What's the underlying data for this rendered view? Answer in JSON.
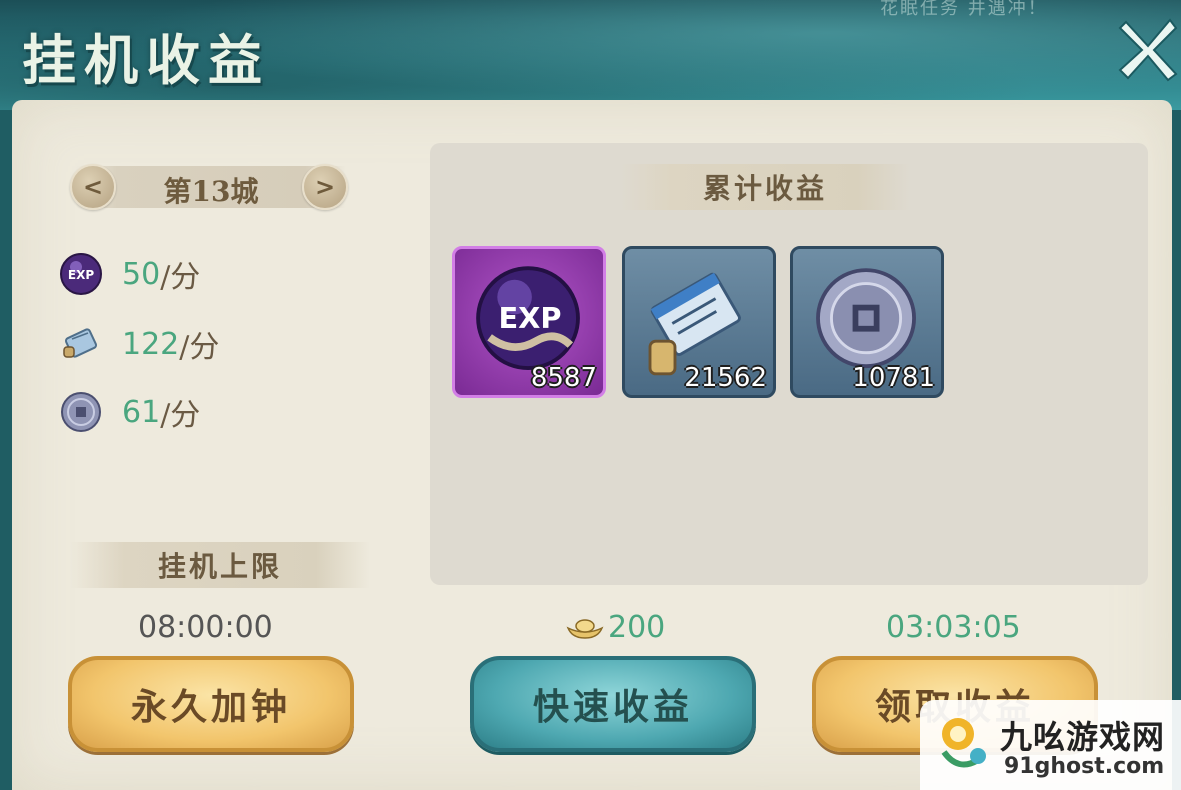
{
  "header": {
    "title": "挂机收益",
    "top_hint": "花眠任务  井遇冲！"
  },
  "city_selector": {
    "label": "第13城",
    "prev_symbol": "<",
    "next_symbol": ">"
  },
  "rates": [
    {
      "icon": "exp-orb-icon",
      "value": "50",
      "unit": "/分"
    },
    {
      "icon": "scroll-icon",
      "value": "122",
      "unit": "/分"
    },
    {
      "icon": "coin-icon",
      "value": "61",
      "unit": "/分"
    }
  ],
  "rewards": {
    "header": "累计收益",
    "items": [
      {
        "icon": "exp-orb-icon",
        "count": "8587",
        "frame": "purple"
      },
      {
        "icon": "scroll-icon",
        "count": "21562",
        "frame": "blue"
      },
      {
        "icon": "coin-icon",
        "count": "10781",
        "frame": "blue"
      }
    ]
  },
  "idle_limit": {
    "header": "挂机上限",
    "time": "08:00:00"
  },
  "quick_gain": {
    "cost_icon": "ingot-icon",
    "cost": "200"
  },
  "timer": "03:03:05",
  "buttons": {
    "extend": "永久加钟",
    "quick": "快速收益",
    "claim": "领取收益"
  },
  "watermark": {
    "title": "九吆游戏网",
    "url": "91ghost.com"
  },
  "colors": {
    "accent_green": "#4aa67f",
    "banner_teal": "#2b7a82",
    "parchment": "#eeeadd",
    "gold_button": "#f2c56c",
    "teal_button": "#4ea8b1"
  }
}
